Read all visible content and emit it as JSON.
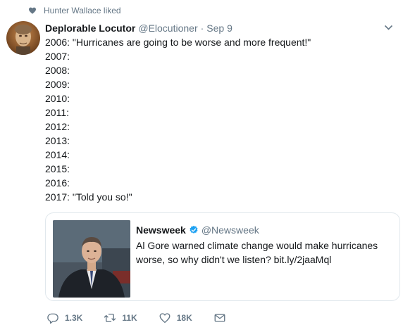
{
  "social_context": {
    "text": "Hunter Wallace liked",
    "icon": "heart-icon"
  },
  "tweet": {
    "author_name": "Deplorable Locutor",
    "handle": "@Elocutioner",
    "separator": "·",
    "date": "Sep 9",
    "lines": [
      "2006: \"Hurricanes are going to be worse and more frequent!\"",
      "2007:",
      "2008:",
      "2009:",
      "2010:",
      "2011:",
      "2012:",
      "2013:",
      "2014:",
      "2015:",
      "2016:",
      "2017: \"Told you so!\""
    ]
  },
  "quote": {
    "author_name": "Newsweek",
    "handle": "@Newsweek",
    "text": "Al Gore warned climate change would make hurricanes worse, so why didn't we listen? bit.ly/2jaaMql"
  },
  "actions": {
    "reply_count": "1.3K",
    "retweet_count": "11K",
    "like_count": "18K"
  },
  "colors": {
    "text": "#14171a",
    "secondary": "#657786",
    "border": "#e1e8ed",
    "verified": "#1da1f2"
  }
}
